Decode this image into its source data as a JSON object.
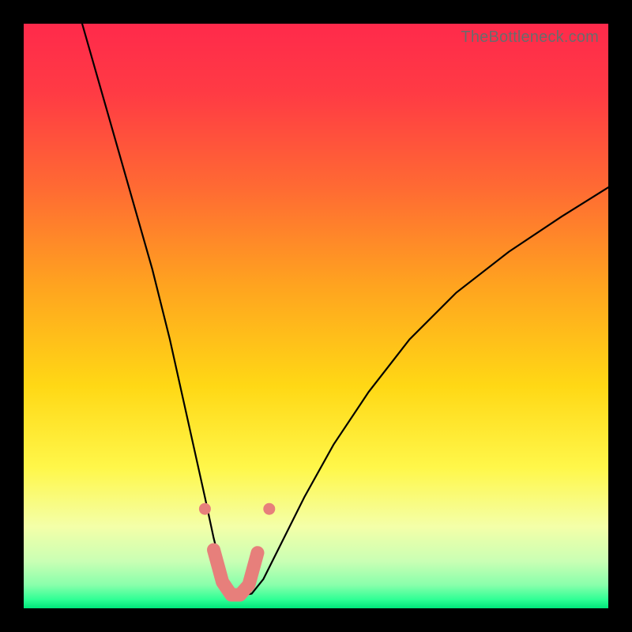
{
  "watermark": "TheBottleneck.com",
  "colors": {
    "frame": "#000000",
    "curve_stroke": "#000000",
    "marker_fill": "#e77f7b",
    "gradient_stops": [
      {
        "offset": 0.0,
        "color": "#ff2a4b"
      },
      {
        "offset": 0.12,
        "color": "#ff3b44"
      },
      {
        "offset": 0.28,
        "color": "#ff6a33"
      },
      {
        "offset": 0.45,
        "color": "#ffa41f"
      },
      {
        "offset": 0.62,
        "color": "#ffd815"
      },
      {
        "offset": 0.76,
        "color": "#fff74a"
      },
      {
        "offset": 0.86,
        "color": "#f4ffa8"
      },
      {
        "offset": 0.92,
        "color": "#c9ffb4"
      },
      {
        "offset": 0.96,
        "color": "#89ffab"
      },
      {
        "offset": 0.985,
        "color": "#2fff95"
      },
      {
        "offset": 1.0,
        "color": "#00e67a"
      }
    ]
  },
  "chart_data": {
    "type": "line",
    "title": "",
    "xlabel": "",
    "ylabel": "",
    "xlim": [
      0,
      100
    ],
    "ylim": [
      0,
      100
    ],
    "grid": false,
    "series": [
      {
        "name": "bottleneck-curve",
        "x": [
          10,
          14,
          18,
          22,
          25,
          27,
          29,
          31,
          32.5,
          34,
          35.5,
          37,
          39,
          41,
          44,
          48,
          53,
          59,
          66,
          74,
          83,
          92,
          100
        ],
        "values": [
          100,
          86,
          72,
          58,
          46,
          37,
          28,
          19,
          12,
          6,
          2.5,
          2.2,
          2.5,
          5,
          11,
          19,
          28,
          37,
          46,
          54,
          61,
          67,
          72
        ]
      }
    ],
    "markers": {
      "name": "highlight-segment",
      "comment": "rounded pink segment + two dots near valley",
      "dots": [
        {
          "x": 31.0,
          "y": 17
        },
        {
          "x": 42.0,
          "y": 17
        }
      ],
      "segment": [
        {
          "x": 32.5,
          "y": 10
        },
        {
          "x": 34.0,
          "y": 4.5
        },
        {
          "x": 35.5,
          "y": 2.3
        },
        {
          "x": 37.0,
          "y": 2.3
        },
        {
          "x": 38.5,
          "y": 4.0
        },
        {
          "x": 40.0,
          "y": 9.5
        }
      ]
    }
  }
}
